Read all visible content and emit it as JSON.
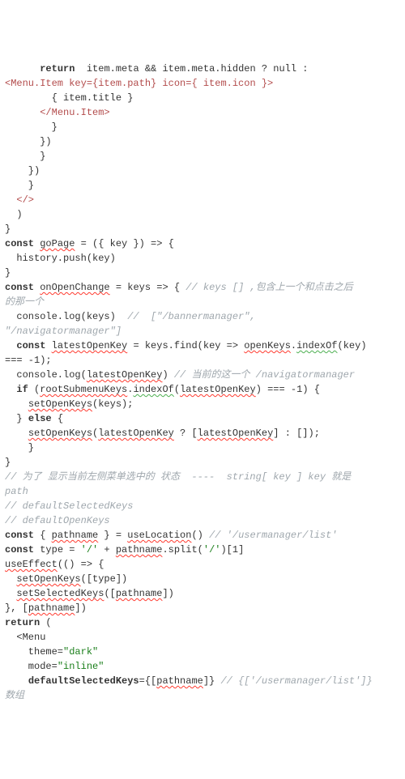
{
  "code": {
    "lines": [
      {
        "i": "      ",
        "segs": [
          {
            "t": "return",
            "c": "kw"
          },
          {
            "t": "  item.meta && item.meta.hidden ? null :"
          }
        ]
      },
      {
        "i": "",
        "segs": [
          {
            "t": "<Menu.Item key={item.path} icon={ item.icon }>",
            "c": "tag"
          }
        ]
      },
      {
        "i": "      ",
        "segs": [
          {
            "t": "  { item.title }"
          }
        ]
      },
      {
        "i": "      ",
        "segs": [
          {
            "t": "</Menu.Item>",
            "c": "tag"
          }
        ]
      },
      {
        "i": "      ",
        "segs": [
          {
            "t": "  }"
          }
        ]
      },
      {
        "i": "      ",
        "segs": [
          {
            "t": "})"
          }
        ]
      },
      {
        "i": "      ",
        "segs": [
          {
            "t": "}"
          }
        ]
      },
      {
        "i": "    ",
        "segs": [
          {
            "t": "})"
          }
        ]
      },
      {
        "i": "    ",
        "segs": [
          {
            "t": "}"
          }
        ]
      },
      {
        "i": "  ",
        "segs": [
          {
            "t": "</>",
            "c": "tag"
          }
        ]
      },
      {
        "i": "  ",
        "segs": [
          {
            "t": ")"
          }
        ]
      },
      {
        "i": "",
        "segs": [
          {
            "t": "}"
          }
        ]
      },
      {
        "i": "",
        "segs": [
          {
            "t": "const",
            "c": "kw"
          },
          {
            "t": " "
          },
          {
            "t": "goPage",
            "c": "sq"
          },
          {
            "t": " = ({ key }) => {"
          }
        ]
      },
      {
        "i": "  ",
        "segs": [
          {
            "t": "history.push(key)"
          }
        ]
      },
      {
        "i": "",
        "segs": [
          {
            "t": "}"
          }
        ]
      },
      {
        "i": "",
        "segs": [
          {
            "t": ""
          }
        ]
      },
      {
        "i": "",
        "segs": [
          {
            "t": "const",
            "c": "kw"
          },
          {
            "t": " "
          },
          {
            "t": "onOpenChange",
            "c": "sq"
          },
          {
            "t": " = keys => { "
          },
          {
            "t": "// keys [] ,包含上一个和点击之后",
            "c": "cm"
          }
        ]
      },
      {
        "i": "",
        "segs": [
          {
            "t": "的那一个",
            "c": "cm"
          }
        ]
      },
      {
        "i": "  ",
        "segs": [
          {
            "t": "console.log(keys)  "
          },
          {
            "t": "//  [\"/bannermanager\",",
            "c": "cm"
          }
        ]
      },
      {
        "i": "",
        "segs": [
          {
            "t": "\"/navigatormanager\"]",
            "c": "cm"
          }
        ]
      },
      {
        "i": "  ",
        "segs": [
          {
            "t": "const",
            "c": "kw"
          },
          {
            "t": " "
          },
          {
            "t": "latestOpenKey",
            "c": "sq"
          },
          {
            "t": " = keys.find(key => "
          },
          {
            "t": "openKeys",
            "c": "sq"
          },
          {
            "t": "."
          },
          {
            "t": "indexOf",
            "c": "sg"
          },
          {
            "t": "(key)"
          }
        ]
      },
      {
        "i": "",
        "segs": [
          {
            "t": "=== -1);"
          }
        ]
      },
      {
        "i": "  ",
        "segs": [
          {
            "t": "console.log("
          },
          {
            "t": "latestOpenKey",
            "c": "sq"
          },
          {
            "t": ") "
          },
          {
            "t": "// 当前的这一个 /navigatormanager",
            "c": "cm"
          }
        ]
      },
      {
        "i": "  ",
        "segs": [
          {
            "t": "if",
            "c": "kw"
          },
          {
            "t": " ("
          },
          {
            "t": "rootSubmenuKeys",
            "c": "sq"
          },
          {
            "t": "."
          },
          {
            "t": "indexOf",
            "c": "sg"
          },
          {
            "t": "("
          },
          {
            "t": "latestOpenKey",
            "c": "sq"
          },
          {
            "t": ") === -1) {"
          }
        ]
      },
      {
        "i": "    ",
        "segs": [
          {
            "t": "setOpenKeys",
            "c": "sq"
          },
          {
            "t": "(keys);"
          }
        ]
      },
      {
        "i": "  ",
        "segs": [
          {
            "t": "} "
          },
          {
            "t": "else",
            "c": "kw"
          },
          {
            "t": " {"
          }
        ]
      },
      {
        "i": "    ",
        "segs": [
          {
            "t": "setOpenKeys",
            "c": "sq"
          },
          {
            "t": "("
          },
          {
            "t": "latestOpenKey",
            "c": "sq"
          },
          {
            "t": " ? ["
          },
          {
            "t": "latestOpenKey",
            "c": "sq"
          },
          {
            "t": "] : []);"
          }
        ]
      },
      {
        "i": "    ",
        "segs": [
          {
            "t": "}"
          }
        ]
      },
      {
        "i": "",
        "segs": [
          {
            "t": "}"
          }
        ]
      },
      {
        "i": "",
        "segs": [
          {
            "t": "// 为了 显示当前左侧菜单选中的 状态  ----  string[ key ] key 就是",
            "c": "cm"
          }
        ]
      },
      {
        "i": "",
        "segs": [
          {
            "t": "path",
            "c": "cm"
          }
        ]
      },
      {
        "i": "",
        "segs": [
          {
            "t": "// defaultSelectedKeys",
            "c": "cm"
          }
        ]
      },
      {
        "i": "",
        "segs": [
          {
            "t": "// defaultOpenKeys",
            "c": "cm"
          }
        ]
      },
      {
        "i": "",
        "segs": [
          {
            "t": "const",
            "c": "kw"
          },
          {
            "t": " { "
          },
          {
            "t": "pathname",
            "c": "sq"
          },
          {
            "t": " } = "
          },
          {
            "t": "useLocation",
            "c": "sq"
          },
          {
            "t": "() "
          },
          {
            "t": "// '/usermanager/list'",
            "c": "cm"
          }
        ]
      },
      {
        "i": "",
        "segs": [
          {
            "t": "const",
            "c": "kw"
          },
          {
            "t": " type = "
          },
          {
            "t": "'/'",
            "c": "str"
          },
          {
            "t": " + "
          },
          {
            "t": "pathname",
            "c": "sq"
          },
          {
            "t": ".split("
          },
          {
            "t": "'/'",
            "c": "str"
          },
          {
            "t": ")[1]"
          }
        ]
      },
      {
        "i": "",
        "segs": [
          {
            "t": ""
          }
        ]
      },
      {
        "i": "",
        "segs": [
          {
            "t": "useEffect",
            "c": "sq"
          },
          {
            "t": "(() => {"
          }
        ]
      },
      {
        "i": "  ",
        "segs": [
          {
            "t": "setOpenKeys",
            "c": "sq"
          },
          {
            "t": "([type])"
          }
        ]
      },
      {
        "i": "  ",
        "segs": [
          {
            "t": "setSelectedKeys",
            "c": "sq"
          },
          {
            "t": "(["
          },
          {
            "t": "pathname",
            "c": "sq"
          },
          {
            "t": "])"
          }
        ]
      },
      {
        "i": "",
        "segs": [
          {
            "t": "}, ["
          },
          {
            "t": "pathname",
            "c": "sq"
          },
          {
            "t": "])"
          }
        ]
      },
      {
        "i": "",
        "segs": [
          {
            "t": "return",
            "c": "kw"
          },
          {
            "t": " ("
          }
        ]
      },
      {
        "i": "  ",
        "segs": [
          {
            "t": "<Menu"
          }
        ]
      },
      {
        "i": "    ",
        "segs": [
          {
            "t": "theme="
          },
          {
            "t": "\"dark\"",
            "c": "str"
          }
        ]
      },
      {
        "i": "    ",
        "segs": [
          {
            "t": "mode="
          },
          {
            "t": "\"inline\"",
            "c": "str"
          }
        ]
      },
      {
        "i": "    ",
        "segs": [
          {
            "t": "defaultSelectedKeys",
            "c": "kw"
          },
          {
            "t": "={["
          },
          {
            "t": "pathname",
            "c": "sq"
          },
          {
            "t": "]} "
          },
          {
            "t": "// {['/usermanager/list']}",
            "c": "cm"
          }
        ]
      },
      {
        "i": "",
        "segs": [
          {
            "t": "数组",
            "c": "cm"
          }
        ]
      }
    ]
  }
}
